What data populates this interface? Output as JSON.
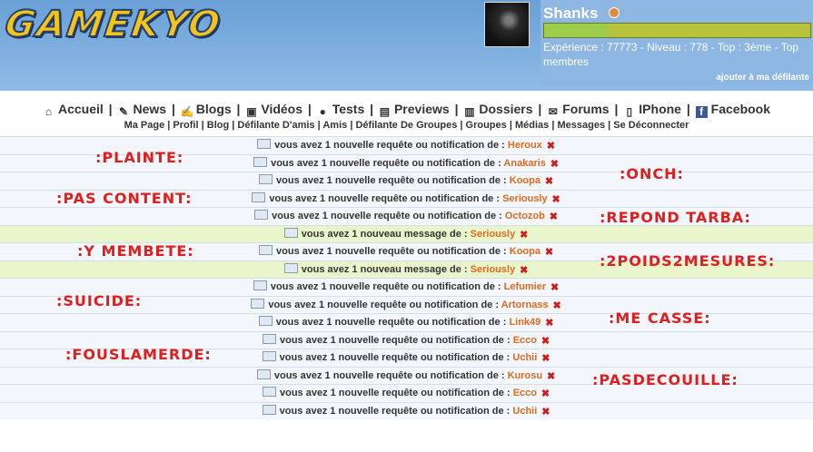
{
  "header": {
    "logo_text": "GAMEKYO",
    "user": {
      "name": "Shanks",
      "stats": "Expérience : 77773 - Niveau : 778 - Top : 3ème - Top membres",
      "add_link": "ajouter à ma défilante",
      "xp_fraction": 0.24
    }
  },
  "nav": {
    "items": [
      {
        "label": "Accueil",
        "icon": "home-icon"
      },
      {
        "label": "News",
        "icon": "news-icon"
      },
      {
        "label": "Blogs",
        "icon": "blogs-icon"
      },
      {
        "label": "Vidéos",
        "icon": "video-icon"
      },
      {
        "label": "Tests",
        "icon": "medal-icon"
      },
      {
        "label": "Previews",
        "icon": "doc-icon"
      },
      {
        "label": "Dossiers",
        "icon": "folder-icon"
      },
      {
        "label": "Forums",
        "icon": "speech-icon"
      },
      {
        "label": "IPhone",
        "icon": "phone-icon"
      },
      {
        "label": "Facebook",
        "icon": "facebook-icon"
      }
    ],
    "sub_items": [
      "Ma Page",
      "Profil",
      "Blog",
      "Défilante D'amis",
      "Amis",
      "Défilante De Groupes",
      "Groupes",
      "Médias",
      "Messages",
      "Se Déconnecter"
    ]
  },
  "notifications": [
    {
      "type": "request",
      "text": "vous avez 1 nouvelle requête ou notification de :",
      "name": "Heroux"
    },
    {
      "type": "request",
      "text": "vous avez 1 nouvelle requête ou notification de :",
      "name": "Anakaris"
    },
    {
      "type": "request",
      "text": "vous avez 1 nouvelle requête ou notification de :",
      "name": "Koopa"
    },
    {
      "type": "request",
      "text": "vous avez 1 nouvelle requête ou notification de :",
      "name": "Seriously"
    },
    {
      "type": "request",
      "text": "vous avez 1 nouvelle requête ou notification de :",
      "name": "Octozob"
    },
    {
      "type": "message",
      "text": "vous avez 1 nouveau message de :",
      "name": "Seriously"
    },
    {
      "type": "request",
      "text": "vous avez 1 nouvelle requête ou notification de :",
      "name": "Koopa"
    },
    {
      "type": "message",
      "text": "vous avez 1 nouveau message de :",
      "name": "Seriously"
    },
    {
      "type": "request",
      "text": "vous avez 1 nouvelle requête ou notification de :",
      "name": "Lefumier"
    },
    {
      "type": "request",
      "text": "vous avez 1 nouvelle requête ou notification de :",
      "name": "Artornass"
    },
    {
      "type": "request",
      "text": "vous avez 1 nouvelle requête ou notification de :",
      "name": "Link49"
    },
    {
      "type": "request",
      "text": "vous avez 1 nouvelle requête ou notification de :",
      "name": "Ecco"
    },
    {
      "type": "request",
      "text": "vous avez 1 nouvelle requête ou notification de :",
      "name": "Uchii"
    },
    {
      "type": "request",
      "text": "vous avez 1 nouvelle requête ou notification de :",
      "name": "Kurosu"
    },
    {
      "type": "request",
      "text": "vous avez 1 nouvelle requête ou notification de :",
      "name": "Ecco"
    },
    {
      "type": "request",
      "text": "vous avez 1 nouvelle requête ou notification de :",
      "name": "Uchii"
    }
  ],
  "stickers": {
    "plainte": ":PLAINTE:",
    "pas_content": ":PAS CONTENT:",
    "y_membete": ":Y MEMBETE:",
    "suicide": ":SUICIDE:",
    "fouslamerde": ":FOUSLAMERDE:",
    "onch": ":ONCH:",
    "repond_tarba": ":REPOND TARBA:",
    "deux_poids": ":2POIDS2MESURES:",
    "me_casse": ":ME CASSE:",
    "pasdecouille": ":PASDECOUILLE:"
  },
  "colors": {
    "header_blue": "#6aa0d6",
    "name_orange": "#e06a1e",
    "sticker_red": "#e01e1e",
    "message_row": "#e9f6cc"
  }
}
